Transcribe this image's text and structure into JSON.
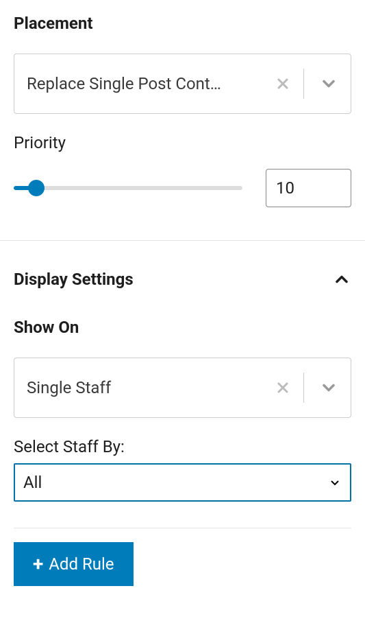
{
  "placement": {
    "title": "Placement",
    "select_value": "Replace Single Post Cont…"
  },
  "priority": {
    "label": "Priority",
    "value": "10"
  },
  "display_settings": {
    "title": "Display Settings"
  },
  "show_on": {
    "title": "Show On",
    "select_value": "Single Staff"
  },
  "select_staff": {
    "label": "Select Staff By:",
    "value": "All"
  },
  "add_rule": {
    "label": "Add Rule"
  }
}
